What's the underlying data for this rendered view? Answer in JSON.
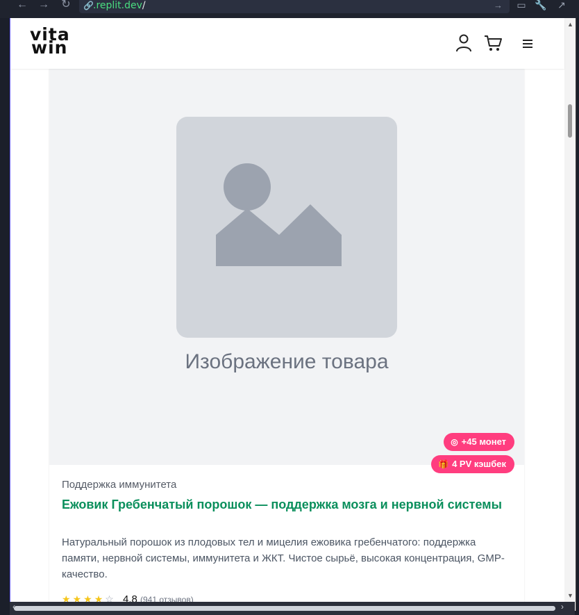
{
  "browser": {
    "url_domain": ".replit.dev",
    "url_slash": "/"
  },
  "header": {
    "logo_line1": "vita",
    "logo_line2": "win"
  },
  "product": {
    "image_caption": "Изображение товара",
    "badge_coins": "+45 монет",
    "badge_cashback": "4 PV кэшбек",
    "category": "Поддержка иммунитета",
    "title": "Ежовик Гребенчатый порошок — поддержка мозга и нервной системы",
    "description": "Натуральный порошок из плодовых тел и мицелия ежовика гребенчатого: поддержка памяти, нервной системы, иммунитета и ЖКТ. Чистое сырьё, высокая концентрация, GMP-качество.",
    "rating": "4.8",
    "reviews": "(941 отзывов)",
    "stars_filled": 4,
    "stars_total": 5
  },
  "colors": {
    "accent_green": "#0a8f5c",
    "badge_pink": "#ff3d7f",
    "star_yellow": "#f5c518"
  }
}
